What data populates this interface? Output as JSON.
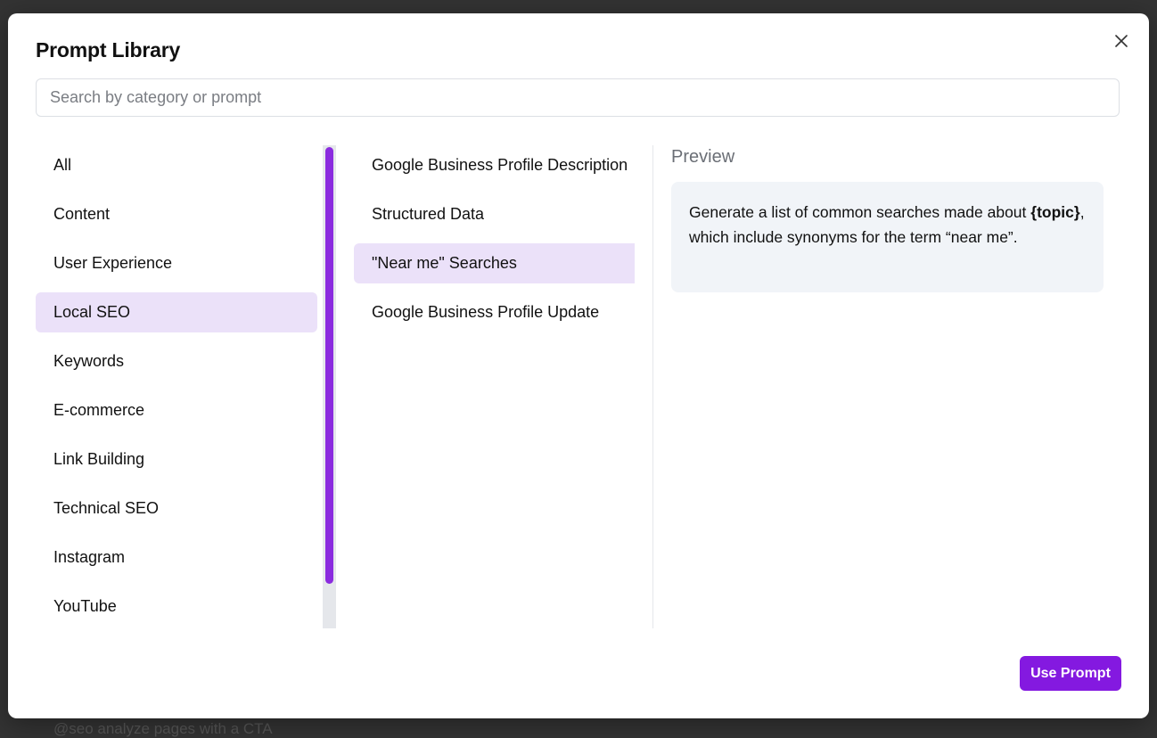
{
  "backdrop": {
    "partial_text": "@seo analyze pages with a CTA"
  },
  "modal": {
    "title": "Prompt Library",
    "close_icon": "close-icon"
  },
  "search": {
    "placeholder": "Search by category or prompt",
    "value": ""
  },
  "categories": {
    "selected": "Local SEO",
    "items": [
      {
        "label": "All"
      },
      {
        "label": "Content"
      },
      {
        "label": "User Experience"
      },
      {
        "label": "Local SEO"
      },
      {
        "label": "Keywords"
      },
      {
        "label": "E-commerce"
      },
      {
        "label": "Link Building"
      },
      {
        "label": "Technical SEO"
      },
      {
        "label": "Instagram"
      },
      {
        "label": "YouTube"
      }
    ]
  },
  "prompts": {
    "selected": "\"Near me\" Searches",
    "items": [
      {
        "label": "Google Business Profile Description"
      },
      {
        "label": "Structured Data"
      },
      {
        "label": "\"Near me\" Searches"
      },
      {
        "label": "Google Business Profile Update"
      }
    ]
  },
  "preview": {
    "label": "Preview",
    "text_before": "Generate a list of common searches made about ",
    "text_bold": "{topic}",
    "text_after": ", which include synonyms for the term “near me”."
  },
  "footer": {
    "use_prompt_label": "Use Prompt"
  },
  "colors": {
    "accent": "#8419e0",
    "selected_bg": "#ebe1f9",
    "scrollbar_thumb": "#8b2bdf",
    "preview_bg": "#f1f4f8"
  }
}
